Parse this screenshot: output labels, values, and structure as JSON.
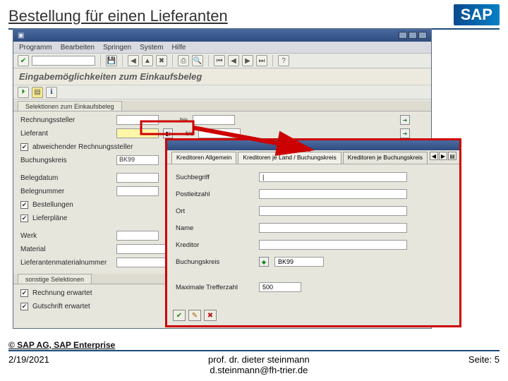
{
  "slide": {
    "title": "Bestellung für einen Lieferanten",
    "logo": "SAP"
  },
  "sapgui": {
    "menubar": [
      "Programm",
      "Bearbeiten",
      "Springen",
      "System",
      "Hilfe"
    ],
    "screen_title": "Eingabemöglichkeiten zum Einkaufsbeleg",
    "section1_tab": "Selektionen zum Einkaufsbeleg",
    "section2_tab": "sonstige Selektionen",
    "rows": {
      "r1": "Rechnungssteller",
      "r2": "Lieferant",
      "r3_chk": "abweichender Rechnungssteller",
      "r4": "Buchungskreis",
      "r4_val": "BK99",
      "r5": "Belegdatum",
      "r6": "Belegnummer",
      "r7_chk": "Bestellungen",
      "r8_chk": "Lieferpläne",
      "r9": "Werk",
      "r10": "Material",
      "r11": "Lieferantenmaterialnummer",
      "s1_chk": "Rechnung erwartet",
      "s2_chk": "Gutschrift erwartet"
    },
    "bis": "bis"
  },
  "popup": {
    "tabs": {
      "t1": "Kreditoren Allgemein",
      "t2": "Kreditoren je Land / Buchungskreis",
      "t3": "Kreditoren je Buchungskreis"
    },
    "fields": {
      "f1": "Suchbegriff",
      "f2": "Postleitzahl",
      "f3": "Ort",
      "f4": "Name",
      "f5": "Kreditor",
      "f6": "Buchungskreis",
      "f6_val": "BK99",
      "f7": "Maximale Trefferzahl",
      "f7_val": "500"
    }
  },
  "footer": {
    "copyright": "© SAP AG, SAP Enterprise",
    "date": "2/19/2021",
    "author1": "prof. dr. dieter steinmann",
    "author2": "d.steinmann@fh-trier.de",
    "page": "Seite: 5"
  }
}
